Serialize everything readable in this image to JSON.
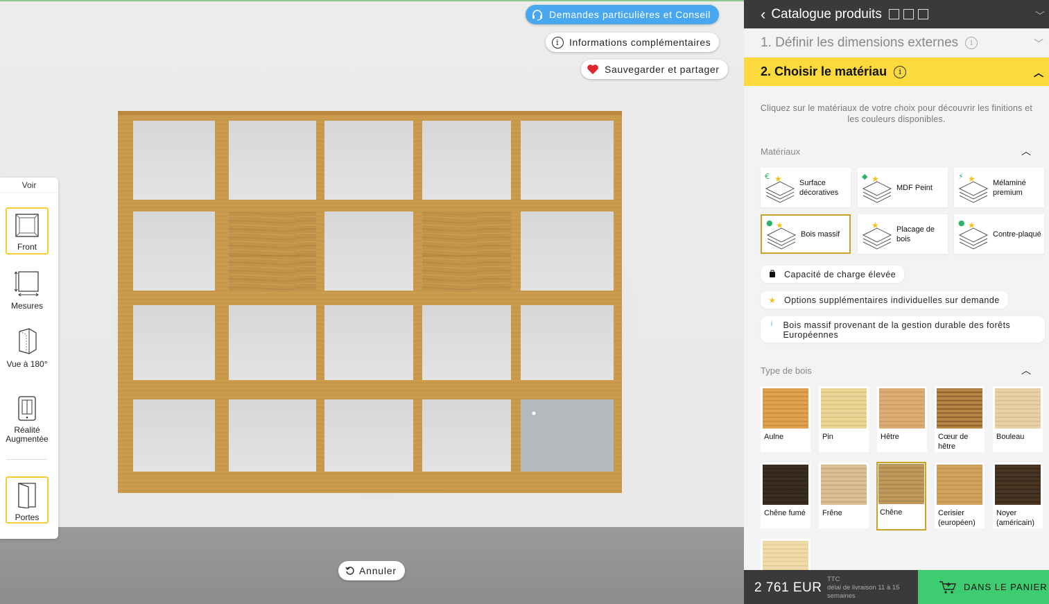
{
  "floating": {
    "consult_label": "Demandes particulières et Conseil",
    "info_label": "Informations complémentaires",
    "save_label": "Sauvegarder et partager",
    "undo_label": "Annuler"
  },
  "viewbar": {
    "title": "Voir",
    "tools": [
      {
        "label": "Front",
        "icon": "front-view-icon",
        "active": true
      },
      {
        "label": "Mesures",
        "icon": "measure-icon",
        "active": false
      },
      {
        "label": "Vue à 180°",
        "icon": "rotate-view-icon",
        "active": false
      },
      {
        "label": "Réalité Augmentée",
        "icon": "ar-icon",
        "active": false
      },
      {
        "label": "Portes",
        "icon": "door-icon",
        "active": true
      }
    ]
  },
  "panel": {
    "header_title": "Catalogue produits",
    "step1_label": "1. Définir les dimensions externes",
    "step2_label": "2. Choisir le matériau",
    "intro": "Cliquez sur le matériaux de votre choix pour découvrir les finitions et les couleurs disponibles.",
    "materials_title": "Matériaux",
    "materials": [
      {
        "label": "Surface décoratives",
        "selected": false
      },
      {
        "label": "MDF Peint",
        "selected": false
      },
      {
        "label": "Mélaminé premium",
        "selected": false
      },
      {
        "label": "Bois massif",
        "selected": true
      },
      {
        "label": "Placage de bois",
        "selected": false
      },
      {
        "label": "Contre-plaqué",
        "selected": false
      }
    ],
    "chips": [
      {
        "icon": "weight-icon",
        "label": "Capacité de charge élevée"
      },
      {
        "icon": "star-icon",
        "label": "Options supplémentaires individuelles sur demande"
      },
      {
        "icon": "info-icon",
        "label": "Bois massif provenant de la gestion durable des forêts Européennes"
      }
    ],
    "wood_title": "Type de bois",
    "woods": [
      {
        "label": "Aulne",
        "color": "#e0a24e",
        "grain": "#c98a36",
        "selected": false
      },
      {
        "label": "Pin",
        "color": "#ecd79a",
        "grain": "#d9bf78",
        "selected": false
      },
      {
        "label": "Hêtre",
        "color": "#dcae76",
        "grain": "#c99a60",
        "selected": false
      },
      {
        "label": "Cœur de hêtre",
        "color": "#b98745",
        "grain": "#7c5226",
        "selected": false
      },
      {
        "label": "Bouleau",
        "color": "#e8d1a4",
        "grain": "#d6bb88",
        "selected": false
      },
      {
        "label": "Chêne fumé",
        "color": "#3b2d22",
        "grain": "#2a1f16",
        "selected": false
      },
      {
        "label": "Frêne",
        "color": "#dcc095",
        "grain": "#c8a676",
        "selected": false
      },
      {
        "label": "Chêne",
        "color": "#bf9a5c",
        "grain": "#a5834a",
        "selected": true
      },
      {
        "label": "Cerisier (européen)",
        "color": "#d3a35d",
        "grain": "#bf8d48",
        "selected": false
      },
      {
        "label": "Noyer (américain)",
        "color": "#4a3422",
        "grain": "#33231a",
        "selected": false
      },
      {
        "label": "",
        "color": "#f0dcaa",
        "grain": "#e2c98e",
        "selected": false
      }
    ],
    "price": "2 761 EUR",
    "ttc": "TTC",
    "delivery": "délai de livraison 11 à 15 semaines",
    "cart_label": "DANS LE PANIER"
  },
  "colors": {
    "accent": "#fcd93c",
    "cart": "#3dcc6f",
    "consult": "#49a7f0",
    "wood": "#c89a4a"
  }
}
